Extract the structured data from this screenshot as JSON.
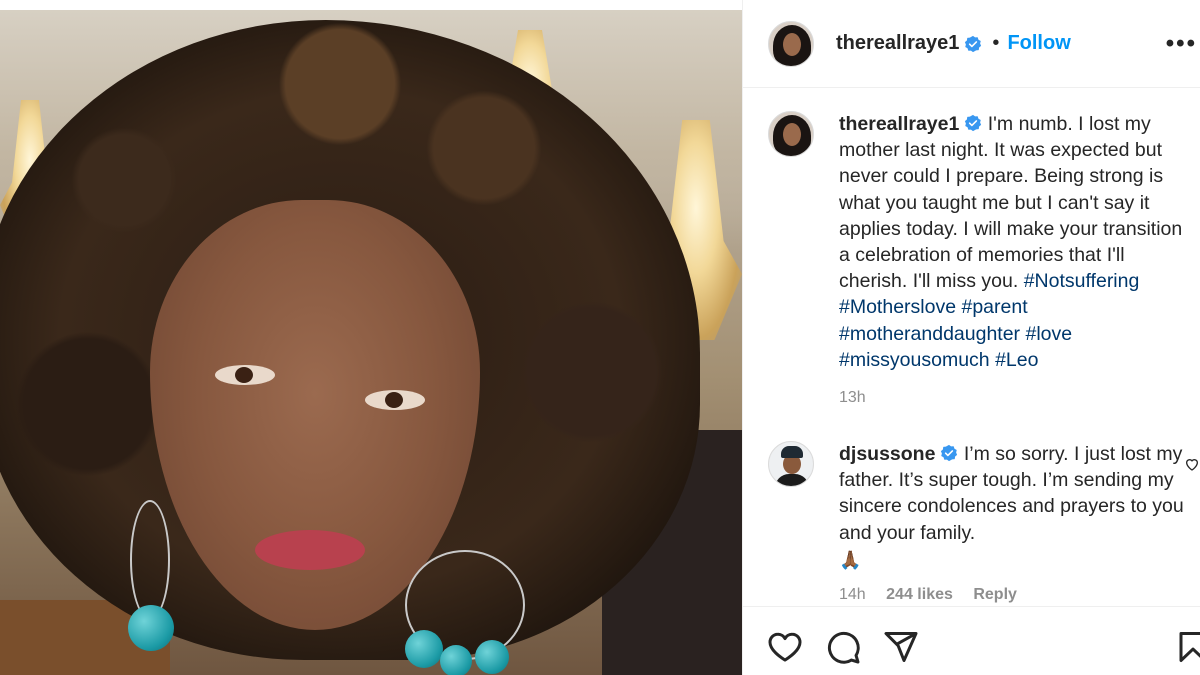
{
  "post": {
    "username": "thereallraye1",
    "follow_label": "Follow",
    "separator": "•",
    "more_label": "•••"
  },
  "caption": {
    "username": "thereallraye1",
    "text": "I'm numb. I lost my mother last night. It was expected but never could I prepare. Being strong is what you taught me but I can't say it applies today. I will make your transition a celebration of memories that I'll cherish. I'll miss you.",
    "hashtags": [
      "#Notsuffering",
      "#Motherslove",
      "#parent",
      "#motheranddaughter",
      "#love",
      "#missyousomuch",
      "#Leo"
    ],
    "time": "13h"
  },
  "comment": {
    "username": "djsussone",
    "text": "I’m so sorry. I just lost my father. It’s super tough. I’m sending my sincere condolences and prayers to you and your family.",
    "emoji": "🙏🏾",
    "time": "14h",
    "likes": "244 likes",
    "reply": "Reply"
  },
  "icons": {
    "like": "heart-icon",
    "comment": "comment-icon",
    "share": "send-icon",
    "save": "bookmark-icon",
    "verified": "verified-badge-icon"
  },
  "colors": {
    "link": "#0095f6",
    "hashtag": "#00376b",
    "verified": "#3897f0",
    "meta": "#8e8e8e"
  }
}
